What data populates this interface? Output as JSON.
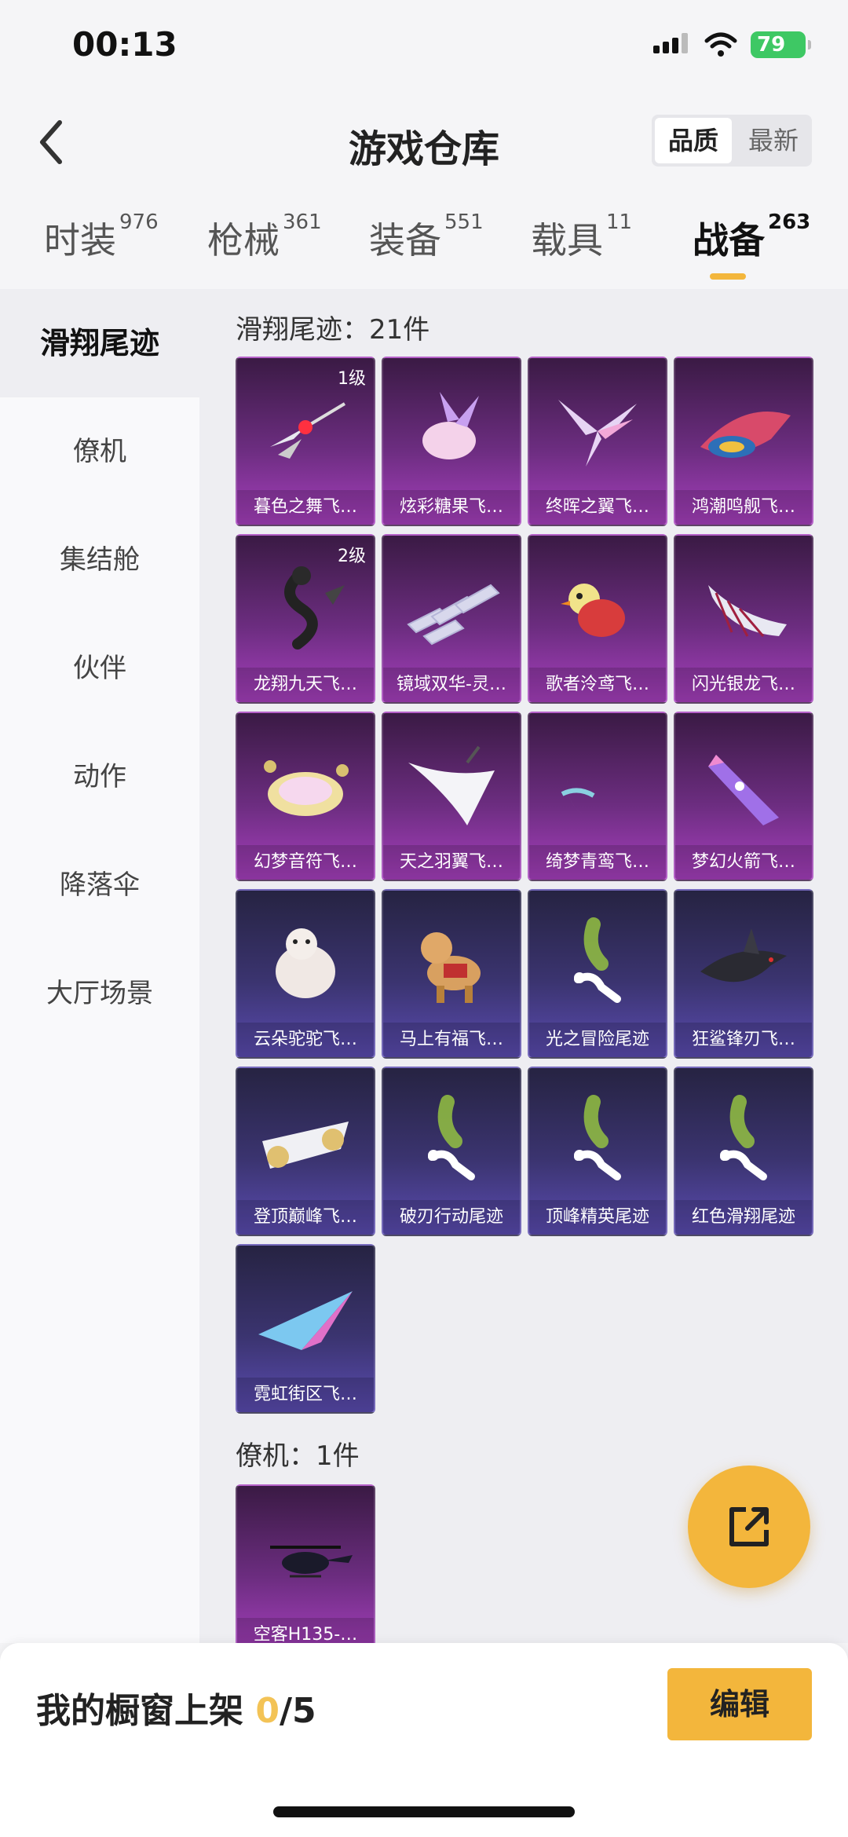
{
  "status": {
    "time": "00:13",
    "battery": "79"
  },
  "header": {
    "title": "游戏仓库",
    "sort_options": [
      "品质",
      "最新"
    ],
    "sort_selected": "品质"
  },
  "tabs": [
    {
      "label": "时装",
      "count": "976"
    },
    {
      "label": "枪械",
      "count": "361"
    },
    {
      "label": "装备",
      "count": "551"
    },
    {
      "label": "载具",
      "count": "11"
    },
    {
      "label": "战备",
      "count": "263"
    }
  ],
  "sidebar": [
    "滑翔尾迹",
    "僚机",
    "集结舱",
    "伙伴",
    "动作",
    "降落伞",
    "大厅场景"
  ],
  "sections": [
    {
      "title": "滑翔尾迹：21件",
      "items": [
        {
          "name": "暮色之舞飞…",
          "level": "1级",
          "icon": "dagger-wings-icon",
          "tier": "purple"
        },
        {
          "name": "炫彩糖果飞…",
          "level": "",
          "icon": "candy-icon",
          "tier": "purple"
        },
        {
          "name": "终晖之翼飞…",
          "level": "",
          "icon": "wing-icon",
          "tier": "purple"
        },
        {
          "name": "鸿潮鸣舰飞…",
          "level": "",
          "icon": "ship-icon",
          "tier": "purple"
        },
        {
          "name": "龙翔九天飞…",
          "level": "2级",
          "icon": "dragon-icon",
          "tier": "purple"
        },
        {
          "name": "镜域双华-灵…",
          "level": "",
          "icon": "crystal-icon",
          "tier": "purple"
        },
        {
          "name": "歌者泠鸢飞…",
          "level": "",
          "icon": "bird-icon",
          "tier": "purple"
        },
        {
          "name": "闪光银龙飞…",
          "level": "",
          "icon": "silver-wing-icon",
          "tier": "purple"
        },
        {
          "name": "幻梦音符飞…",
          "level": "",
          "icon": "disc-icon",
          "tier": "purple"
        },
        {
          "name": "天之羽翼飞…",
          "level": "",
          "icon": "feather-wing-icon",
          "tier": "purple"
        },
        {
          "name": "绮梦青鸾飞…",
          "level": "",
          "icon": "moon-icon",
          "tier": "purple"
        },
        {
          "name": "梦幻火箭飞…",
          "level": "",
          "icon": "rocket-icon",
          "tier": "purple"
        },
        {
          "name": "云朵驼驼飞…",
          "level": "",
          "icon": "alpaca-icon",
          "tier": "blue"
        },
        {
          "name": "马上有福飞…",
          "level": "",
          "icon": "horse-icon",
          "tier": "blue"
        },
        {
          "name": "光之冒险尾迹",
          "level": "",
          "icon": "smoke-trail-icon",
          "tier": "blue"
        },
        {
          "name": "狂鲨锋刃飞…",
          "level": "",
          "icon": "shark-icon",
          "tier": "blue"
        },
        {
          "name": "登顶巅峰飞…",
          "level": "",
          "icon": "jet-icon",
          "tier": "blue"
        },
        {
          "name": "破刃行动尾迹",
          "level": "",
          "icon": "smoke-trail-icon",
          "tier": "blue"
        },
        {
          "name": "顶峰精英尾迹",
          "level": "",
          "icon": "smoke-trail-icon",
          "tier": "blue"
        },
        {
          "name": "红色滑翔尾迹",
          "level": "",
          "icon": "smoke-trail-icon",
          "tier": "blue"
        },
        {
          "name": "霓虹街区飞…",
          "level": "",
          "icon": "paper-plane-icon",
          "tier": "blue"
        }
      ]
    },
    {
      "title": "僚机：1件",
      "items": [
        {
          "name": "空客H135-…",
          "level": "",
          "icon": "helicopter-icon",
          "tier": "purple"
        }
      ]
    }
  ],
  "bottom": {
    "label": "我的橱窗上架 ",
    "current": "0",
    "total": "/5",
    "edit_label": "编辑"
  },
  "colors": {
    "accent": "#f3b63c",
    "purple_tier": "#8a36a0",
    "blue_tier": "#4a3f90"
  }
}
